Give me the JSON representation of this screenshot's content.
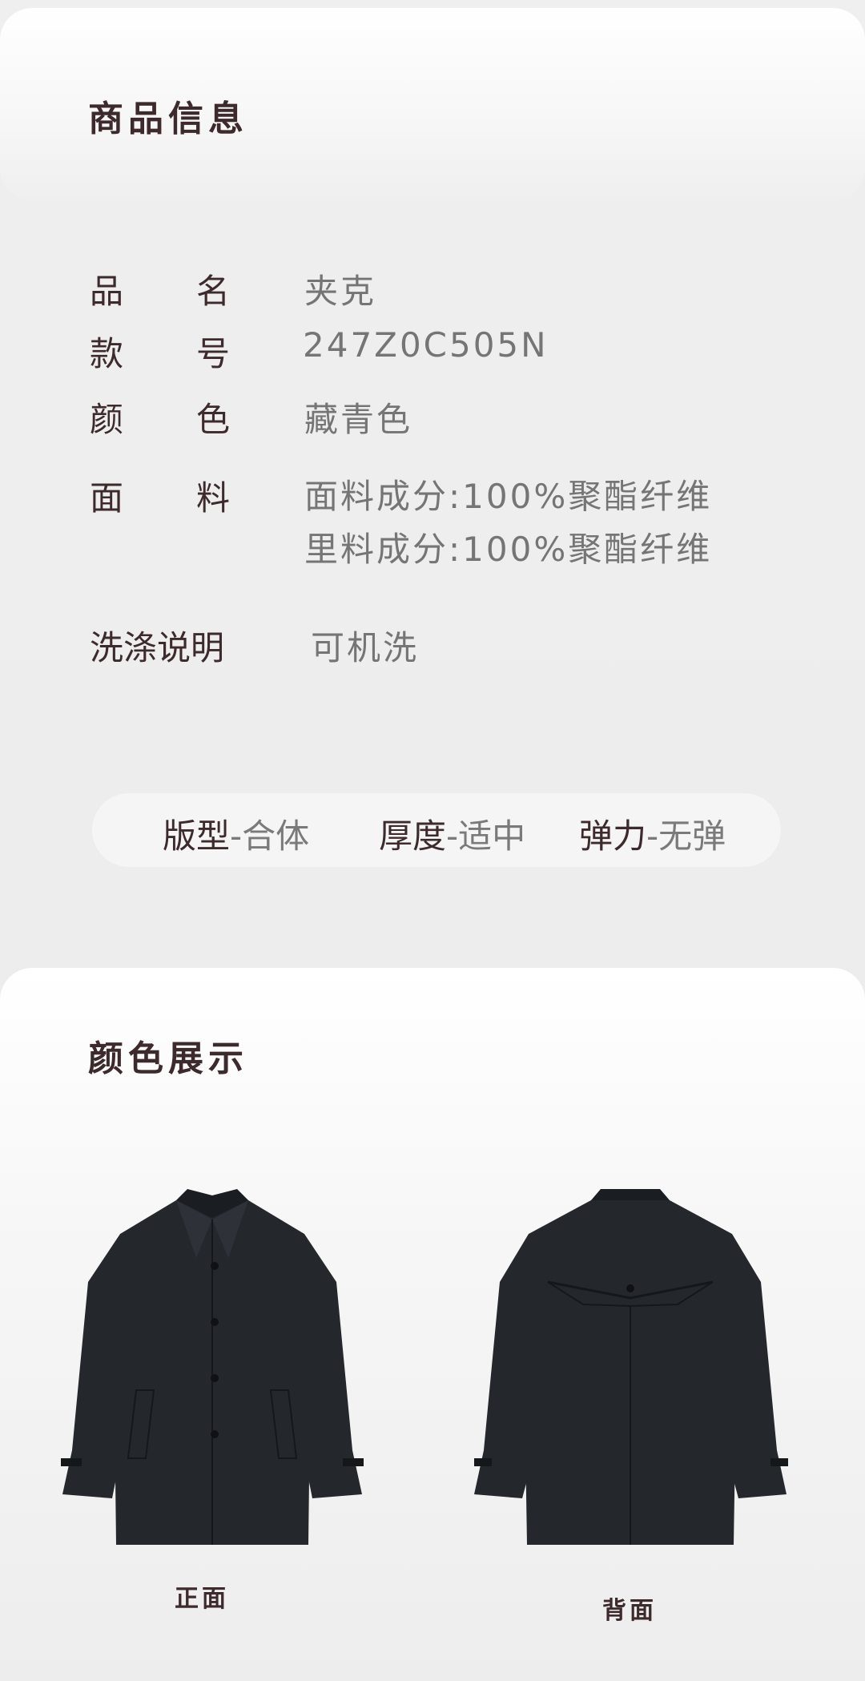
{
  "product_info": {
    "title": "商品信息",
    "rows": [
      {
        "label_a": "品",
        "label_b": "名",
        "value": "夹克"
      },
      {
        "label_a": "款",
        "label_b": "号",
        "value": "247Z0C505N"
      },
      {
        "label_a": "颜",
        "label_b": "色",
        "value": "藏青色"
      },
      {
        "label_a": "面",
        "label_b": "料",
        "value": "面料成分:100%聚酯纤维",
        "value2": "里料成分:100%聚酯纤维"
      }
    ],
    "wash": {
      "label": "洗涤说明",
      "value": "可机洗"
    }
  },
  "attributes": [
    {
      "key": "版型",
      "value": "-合体"
    },
    {
      "key": "厚度",
      "value": "-适中"
    },
    {
      "key": "弹力",
      "value": "-无弹"
    }
  ],
  "color_display": {
    "title": "颜色展示",
    "front_caption": "正面",
    "back_caption": "背面",
    "coat_color": "#24282d"
  }
}
